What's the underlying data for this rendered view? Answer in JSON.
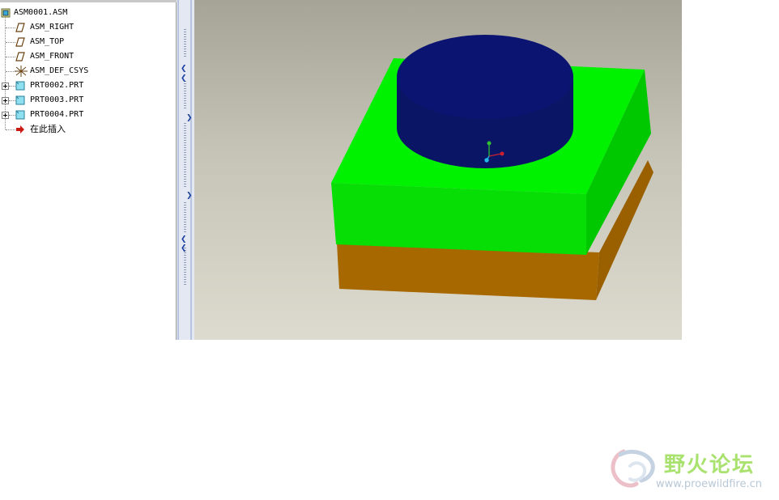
{
  "model_tree": {
    "root": {
      "label": "ASM0001.ASM",
      "icon": "assembly-icon"
    },
    "items": [
      {
        "label": "ASM_RIGHT",
        "icon": "datum-plane-icon"
      },
      {
        "label": "ASM_TOP",
        "icon": "datum-plane-icon"
      },
      {
        "label": "ASM_FRONT",
        "icon": "datum-plane-icon"
      },
      {
        "label": "ASM_DEF_CSYS",
        "icon": "coordinate-system-icon"
      },
      {
        "label": "PRT0002.PRT",
        "icon": "part-icon"
      },
      {
        "label": "PRT0003.PRT",
        "icon": "part-icon"
      },
      {
        "label": "PRT0004.PRT",
        "icon": "part-icon"
      },
      {
        "label": "在此插入",
        "icon": "insert-here-arrow-icon"
      }
    ]
  },
  "sash": {
    "arrows": [
      "collapse-left-arrow-icon",
      "expand-right-arrow-icon",
      "expand-right-arrow-icon",
      "collapse-left-arrow-icon"
    ]
  },
  "viewport": {
    "parts": [
      {
        "name": "cylinder-part",
        "color": "#0b1470"
      },
      {
        "name": "green-block-part",
        "color": "#00ee00"
      },
      {
        "name": "orange-base-part",
        "color": "#a86800"
      }
    ],
    "csys_colors": {
      "x": "#cc2030",
      "y": "#30c030",
      "z": "#22b8e8"
    }
  },
  "watermark": {
    "title": "野火论坛",
    "url": "www.proewildfire.cn"
  }
}
